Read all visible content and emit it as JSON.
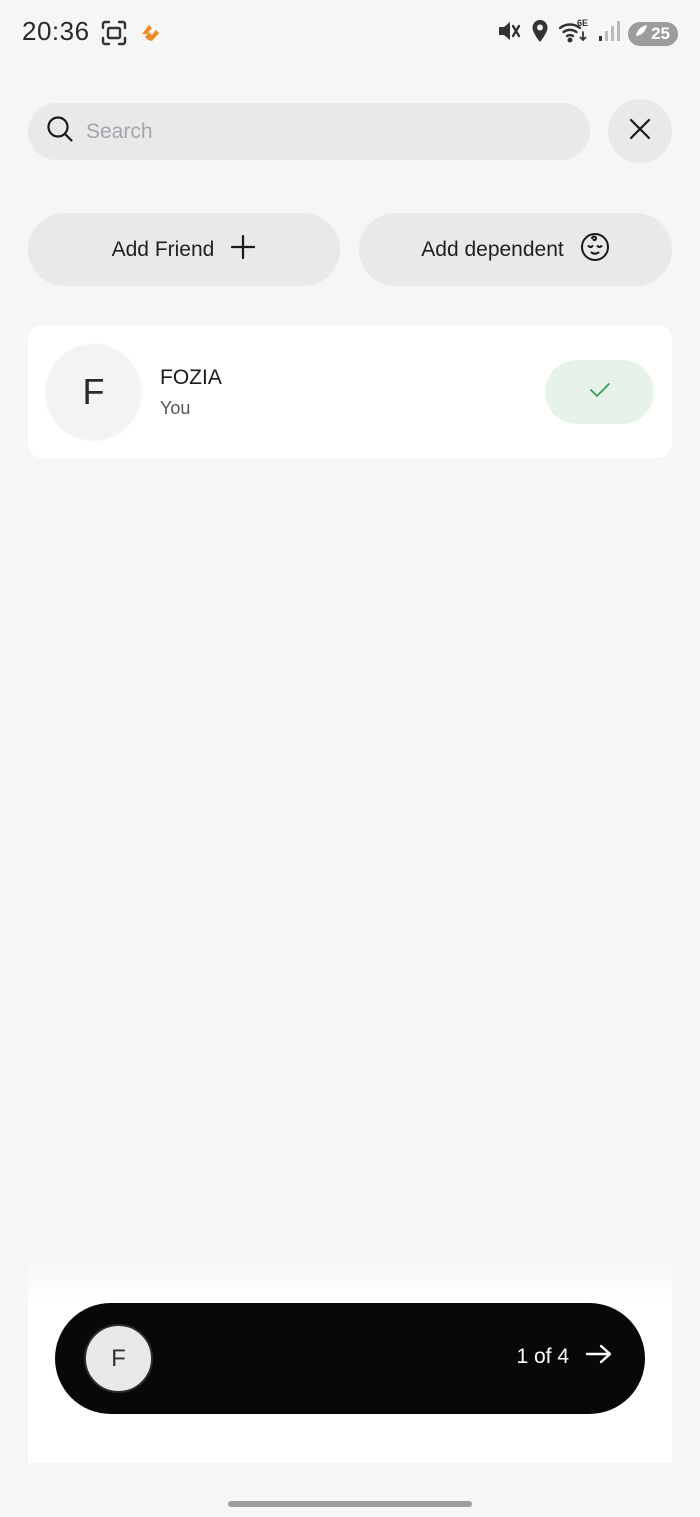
{
  "status_bar": {
    "time": "20:36",
    "battery": "25",
    "icons": [
      "screenshot-icon",
      "app-notification-icon",
      "mute-icon",
      "location-icon",
      "wifi-6e-icon",
      "signal-icon",
      "battery-saver-icon"
    ]
  },
  "search": {
    "placeholder": "Search",
    "value": ""
  },
  "actions": {
    "add_friend_label": "Add Friend",
    "add_dependent_label": "Add dependent"
  },
  "members": [
    {
      "initial": "F",
      "name": "FOZIA",
      "subtitle": "You",
      "selected": true
    }
  ],
  "next_bar": {
    "avatar_initial": "F",
    "progress_text": "1 of 4"
  },
  "colors": {
    "background": "#f6f6f6",
    "pill": "#e8e9ea",
    "check_bg": "#e7f3e9",
    "check": "#3aa056",
    "next_bar": "#070909",
    "accent_orange": "#f08a24"
  }
}
